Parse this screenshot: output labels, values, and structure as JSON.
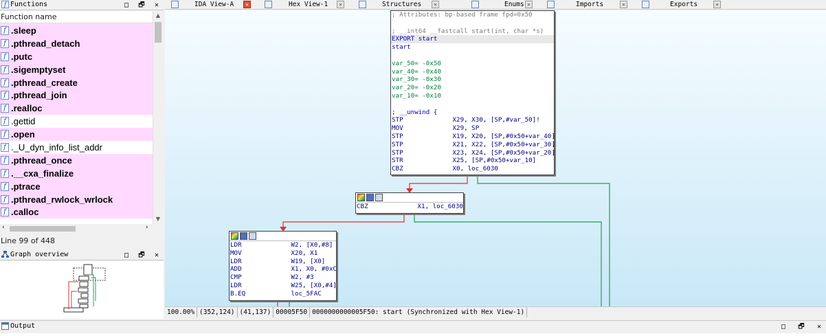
{
  "functions_panel": {
    "title": "Functions",
    "column_header": "Function name",
    "items": [
      {
        "name": ".sleep",
        "bold": true
      },
      {
        "name": ".pthread_detach",
        "bold": true
      },
      {
        "name": ".putc",
        "bold": true
      },
      {
        "name": ".sigemptyset",
        "bold": true
      },
      {
        "name": ".pthread_create",
        "bold": true
      },
      {
        "name": ".pthread_join",
        "bold": true
      },
      {
        "name": ".realloc",
        "bold": true
      },
      {
        "name": ".gettid",
        "bold": false
      },
      {
        "name": ".open",
        "bold": true
      },
      {
        "name": "._U_dyn_info_list_addr",
        "bold": false
      },
      {
        "name": ".pthread_once",
        "bold": true
      },
      {
        "name": ".__cxa_finalize",
        "bold": true
      },
      {
        "name": ".ptrace",
        "bold": true
      },
      {
        "name": ".pthread_rwlock_wrlock",
        "bold": true
      },
      {
        "name": ".calloc",
        "bold": true
      }
    ],
    "line_count": "Line 99 of 448",
    "highlight_color": "#ffd9ff"
  },
  "graph_overview": {
    "title": "Graph overview"
  },
  "window_buttons": {
    "minimize": "□",
    "float": "🗗",
    "close": "✕"
  },
  "tabs": [
    {
      "label": "IDA View-A",
      "icon": "graph-icon",
      "close_red": true
    },
    {
      "label": "Hex View-1",
      "icon": "hex-icon",
      "close_red": false
    },
    {
      "label": "Structures",
      "icon": "struct-icon",
      "close_red": false
    },
    {
      "label": "Enums",
      "icon": "enum-icon",
      "close_red": false
    },
    {
      "label": "Imports",
      "icon": "imports-icon",
      "close_red": false
    },
    {
      "label": "Exports",
      "icon": "exports-icon",
      "close_red": false
    }
  ],
  "blocks": {
    "start": {
      "lines": [
        {
          "t": "; Attributes: bp-based frame fpd=0x50",
          "c": "com"
        },
        {
          "t": "",
          "c": ""
        },
        {
          "t": "; __int64 __fastcall start(int, char *s)",
          "c": "com"
        },
        {
          "t": "EXPORT start",
          "c": "kw",
          "hl": true
        },
        {
          "t": "start",
          "c": "kw"
        },
        {
          "t": "",
          "c": ""
        },
        {
          "t": "var_50= -0x50",
          "c": "var"
        },
        {
          "t": "var_40= -0x40",
          "c": "var"
        },
        {
          "t": "var_30= -0x30",
          "c": "var"
        },
        {
          "t": "var_20= -0x20",
          "c": "var"
        },
        {
          "t": "var_10= -0x10",
          "c": "var"
        },
        {
          "t": "",
          "c": ""
        },
        {
          "t": "; __unwind {",
          "c": "kw"
        },
        {
          "t": "STP             X29, X30, [SP,#var_50]!",
          "c": "mn"
        },
        {
          "t": "MOV             X29, SP",
          "c": "mn"
        },
        {
          "t": "STP             X19, X20, [SP,#0x50+var_40]",
          "c": "mn"
        },
        {
          "t": "STP             X21, X22, [SP,#0x50+var_30]",
          "c": "mn"
        },
        {
          "t": "STP             X23, X24, [SP,#0x50+var_20]",
          "c": "mn"
        },
        {
          "t": "STR             X25, [SP,#0x50+var_10]",
          "c": "mn"
        },
        {
          "t": "CBZ             X0, loc_6030",
          "c": "mn"
        }
      ]
    },
    "cbz_block": {
      "lines": [
        {
          "t": "CBZ             X1, loc_6030",
          "c": "mn"
        }
      ]
    },
    "ldr_block": {
      "lines": [
        {
          "t": "LDR             W2, [X0,#8]",
          "c": "mn"
        },
        {
          "t": "MOV             X20, X1",
          "c": "mn"
        },
        {
          "t": "LDR             W19, [X0]",
          "c": "mn"
        },
        {
          "t": "ADD             X1, X0, #0xC",
          "c": "mn"
        },
        {
          "t": "CMP             W2, #3",
          "c": "mn"
        },
        {
          "t": "LDR             W25, [X0,#4]",
          "c": "mn"
        },
        {
          "t": "B.EQ            loc_5FAC",
          "c": "mn"
        }
      ]
    }
  },
  "status": {
    "zoom": "100.00%",
    "pos1": "(352,124)",
    "pos2": "(41,137)",
    "offset": "00005F50",
    "address_info": "0000000000005F50: start",
    "sync": "(Synchronized with Hex View-1)"
  },
  "output_panel": {
    "title": "Output"
  },
  "colors": {
    "edge_false": "#e03030",
    "edge_true": "#20a050",
    "canvas_top": "#f6fcff",
    "canvas_bottom": "#c8e8f7"
  }
}
